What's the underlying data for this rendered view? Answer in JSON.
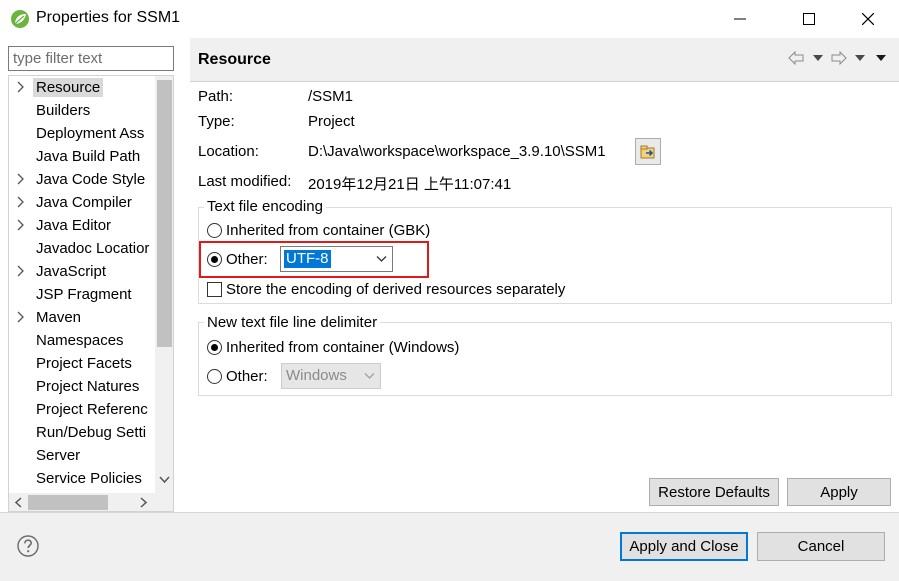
{
  "window": {
    "title": "Properties for SSM1"
  },
  "filter": {
    "placeholder": "type filter text"
  },
  "tree": {
    "items": [
      {
        "label": "Resource",
        "expandable": true,
        "selected": true
      },
      {
        "label": "Builders",
        "expandable": false
      },
      {
        "label": "Deployment Ass",
        "expandable": false
      },
      {
        "label": "Java Build Path",
        "expandable": false
      },
      {
        "label": "Java Code Style",
        "expandable": true
      },
      {
        "label": "Java Compiler",
        "expandable": true
      },
      {
        "label": "Java Editor",
        "expandable": true
      },
      {
        "label": "Javadoc Locatior",
        "expandable": false
      },
      {
        "label": "JavaScript",
        "expandable": true
      },
      {
        "label": "JSP Fragment",
        "expandable": false
      },
      {
        "label": "Maven",
        "expandable": true
      },
      {
        "label": "Namespaces",
        "expandable": false
      },
      {
        "label": "Project Facets",
        "expandable": false
      },
      {
        "label": "Project Natures",
        "expandable": false
      },
      {
        "label": "Project Referenc",
        "expandable": false
      },
      {
        "label": "Run/Debug Setti",
        "expandable": false
      },
      {
        "label": "Server",
        "expandable": false
      },
      {
        "label": "Service Policies",
        "expandable": false
      }
    ]
  },
  "page": {
    "title": "Resource",
    "path_label": "Path:",
    "path_value": "/SSM1",
    "type_label": "Type:",
    "type_value": "Project",
    "location_label": "Location:",
    "location_value": "D:\\Java\\workspace\\workspace_3.9.10\\SSM1",
    "modified_label": "Last modified:",
    "modified_value": "2019年12月21日 上午11:07:41"
  },
  "encoding": {
    "group_title": "Text file encoding",
    "inherited_label": "Inherited from container (GBK)",
    "other_label": "Other:",
    "other_value": "UTF-8",
    "derived_label": "Store the encoding of derived resources separately",
    "selected": "other"
  },
  "delimiter": {
    "group_title": "New text file line delimiter",
    "inherited_label": "Inherited from container (Windows)",
    "other_label": "Other:",
    "other_value": "Windows",
    "selected": "inherited"
  },
  "buttons": {
    "restore_defaults": "Restore Defaults",
    "apply": "Apply",
    "apply_and_close": "Apply and Close",
    "cancel": "Cancel"
  },
  "colors": {
    "accent": "#0078d7",
    "highlight": "#e0191a",
    "panel": "#f0f0f0"
  }
}
